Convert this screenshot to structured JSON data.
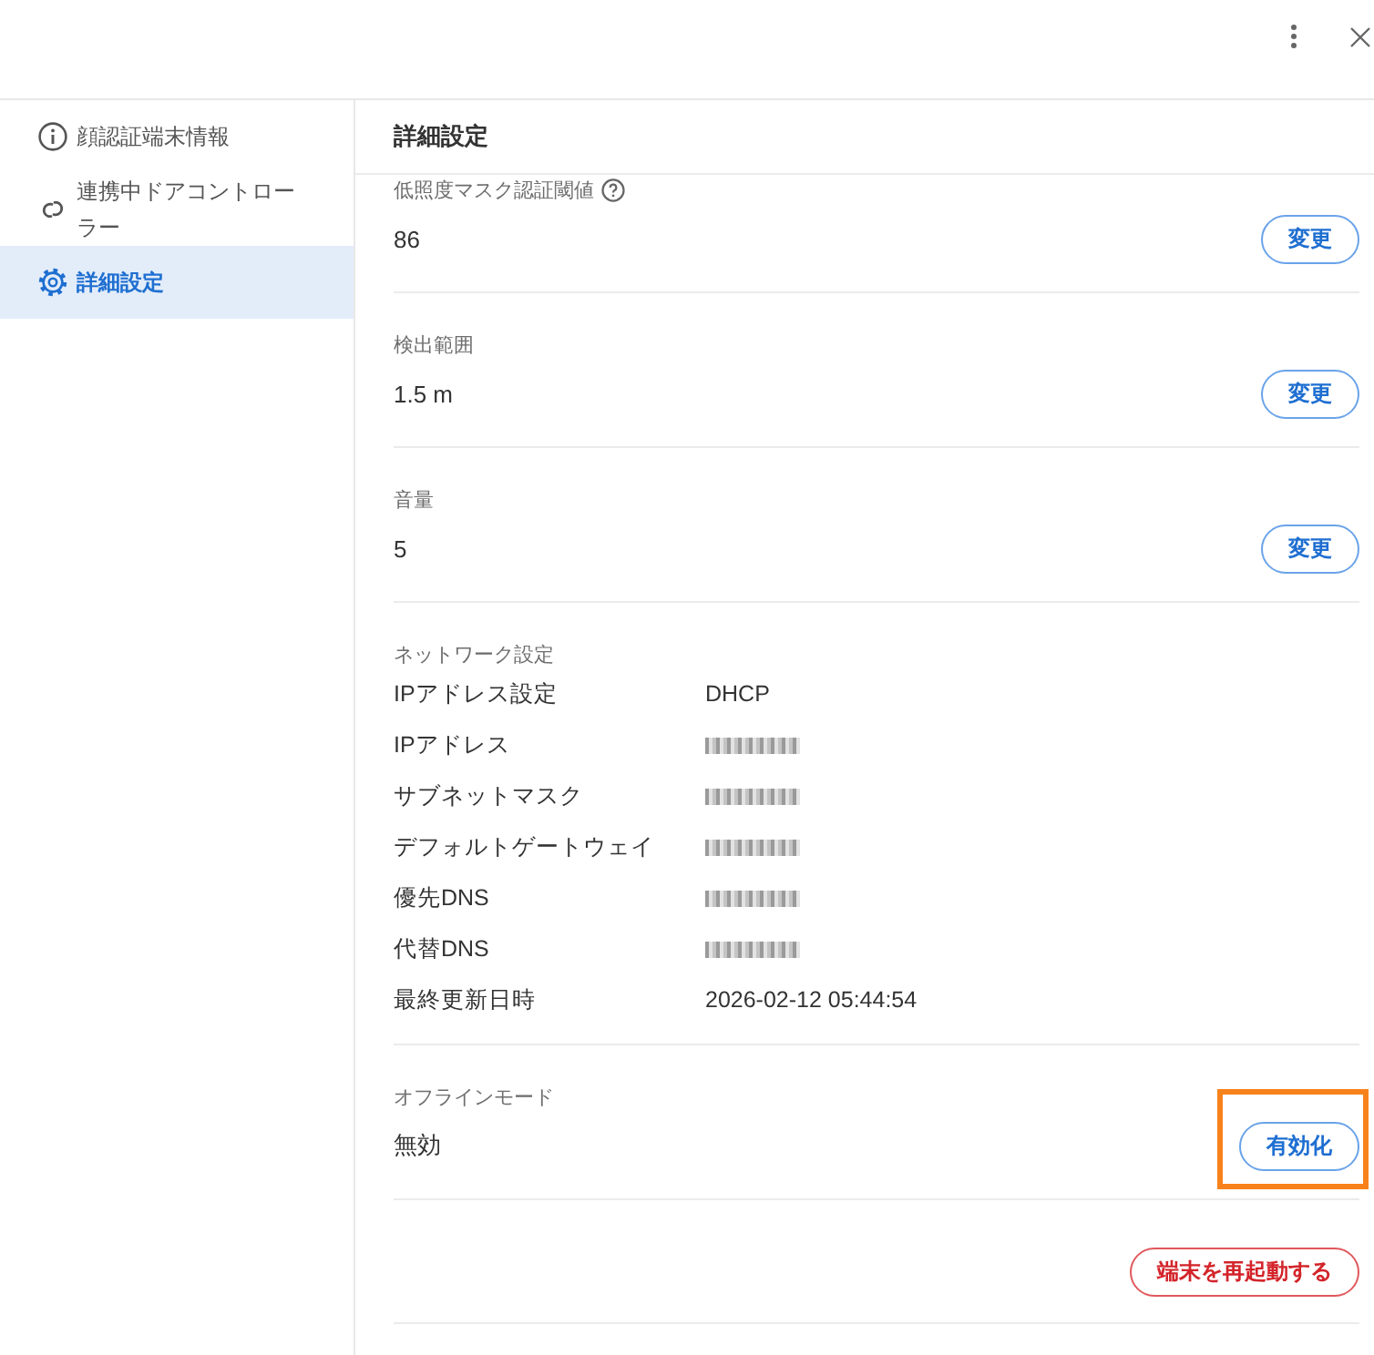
{
  "sidebar": {
    "items": [
      {
        "kind": "info",
        "label": "顔認証端末情報",
        "selected": false
      },
      {
        "kind": "link",
        "label": "連携中ドアコントローラー",
        "selected": false
      },
      {
        "kind": "settings",
        "label": "詳細設定",
        "selected": true
      }
    ]
  },
  "panel": {
    "title": "詳細設定"
  },
  "sections": [
    {
      "kind": "setting",
      "label": "低照度マスク認証閾値",
      "help": true,
      "value": "86",
      "button": {
        "label": "変更",
        "highlighted": false
      }
    },
    {
      "kind": "setting",
      "label": "検出範囲",
      "help": false,
      "value": "1.5 m",
      "button": {
        "label": "変更",
        "highlighted": false
      }
    },
    {
      "kind": "setting",
      "label": "音量",
      "help": false,
      "value": "5",
      "button": {
        "label": "変更",
        "highlighted": false
      }
    },
    {
      "kind": "network",
      "label": "ネットワーク設定",
      "rows": [
        {
          "label": "IPアドレス設定",
          "value": "DHCP",
          "redacted": false
        },
        {
          "label": "IPアドレス",
          "redacted": true
        },
        {
          "label": "サブネットマスク",
          "redacted": true
        },
        {
          "label": "デフォルトゲートウェイ",
          "redacted": true
        },
        {
          "label": "優先DNS",
          "redacted": true
        },
        {
          "label": "代替DNS",
          "redacted": true
        },
        {
          "label": "最終更新日時",
          "value": "2026-02-12 05:44:54",
          "redacted": false
        }
      ]
    },
    {
      "kind": "setting",
      "label": "オフラインモード",
      "help": false,
      "value": "無効",
      "button": {
        "label": "有効化",
        "highlighted": true
      }
    },
    {
      "kind": "action",
      "button": {
        "label": "端末を再起動する"
      }
    }
  ]
}
